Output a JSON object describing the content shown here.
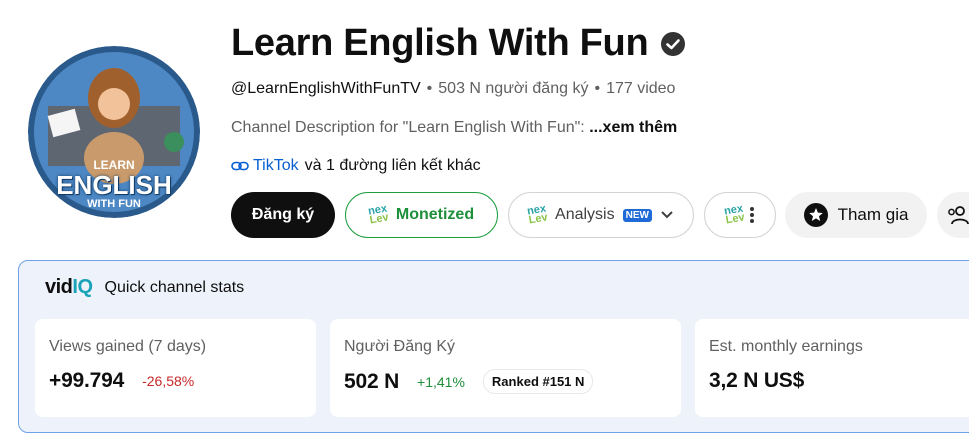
{
  "channel": {
    "name": "Learn English With Fun",
    "handle": "@LearnEnglishWithFunTV",
    "subscribers": "503 N người đăng ký",
    "videos": "177 video",
    "description": "Channel Description for \"Learn English With Fun\":",
    "more_label": "...xem thêm",
    "link_primary": "TikTok",
    "link_others": "và 1 đường liên kết khác",
    "avatar_text": [
      "LEARN",
      "ENGLISH",
      "WITH FUN"
    ]
  },
  "actions": {
    "subscribe": "Đăng ký",
    "monetized": "Monetized",
    "analysis": "Analysis",
    "new_badge": "NEW",
    "nx_top": "nex",
    "nx_bottom": "Lev",
    "join": "Tham gia"
  },
  "stats": {
    "brand": {
      "a": "vid",
      "b": "IQ"
    },
    "title": "Quick channel stats",
    "cards": [
      {
        "label": "Views gained (7 days)",
        "value": "+99.794",
        "change": "-26,58%"
      },
      {
        "label": "Người Đăng Ký",
        "value": "502 N",
        "change": "+1,41%",
        "rank": "Ranked #151 N"
      },
      {
        "label": "Est. monthly earnings",
        "value": "3,2 N US$"
      }
    ]
  },
  "colors": {
    "accent": "#065fd4",
    "monetized": "#1e8f3a",
    "negative": "#c62828",
    "panel": "#eef3fb"
  }
}
